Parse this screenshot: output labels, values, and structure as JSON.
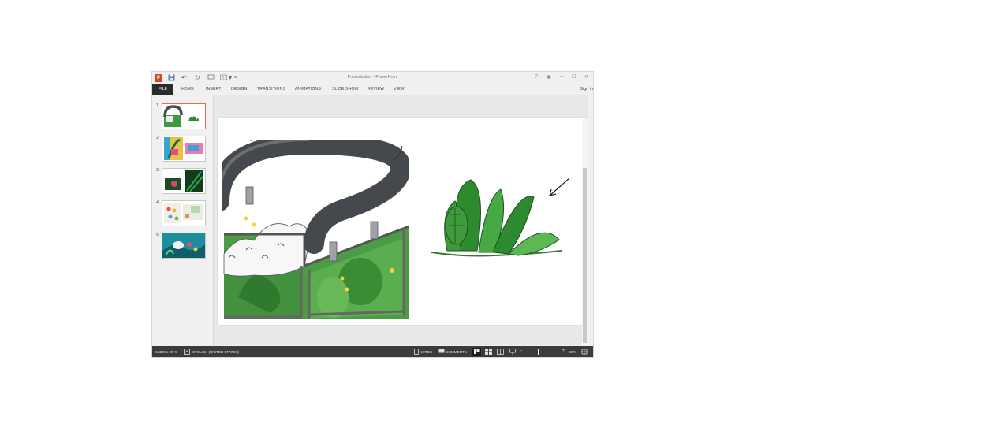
{
  "window": {
    "title": "Presentation - PowerPoint",
    "app_badge": "P",
    "controls": {
      "help": "?",
      "restore_ribbon": "▣",
      "minimize": "—",
      "maximize": "☐",
      "close": "✕"
    }
  },
  "quick_access": {
    "undo_icon": "↶",
    "redo_icon": "↻",
    "customize": "▾"
  },
  "ribbon": {
    "file_tab": "FILE",
    "tabs": [
      "HOME",
      "INSERT",
      "DESIGN",
      "TRANSITIONS",
      "ANIMATIONS",
      "SLIDE SHOW",
      "REVIEW",
      "VIEW"
    ],
    "sign_in": "Sign in"
  },
  "thumbnails": [
    {
      "number": "1",
      "selected": true
    },
    {
      "number": "2",
      "selected": false
    },
    {
      "number": "3",
      "selected": false
    },
    {
      "number": "4",
      "selected": false
    },
    {
      "number": "5",
      "selected": false
    }
  ],
  "status_bar": {
    "slide_info": "SLIDE 1 OF 5",
    "language": "ENGLISH (UNITED STATES)",
    "notes": "NOTES",
    "comments": "COMMENTS",
    "zoom_minus": "-",
    "zoom_plus": "+",
    "zoom": "80%"
  },
  "colors": {
    "accent": "#d24726",
    "status_bg": "#3b3b3b",
    "leaf_green": "#2e8a2e"
  }
}
